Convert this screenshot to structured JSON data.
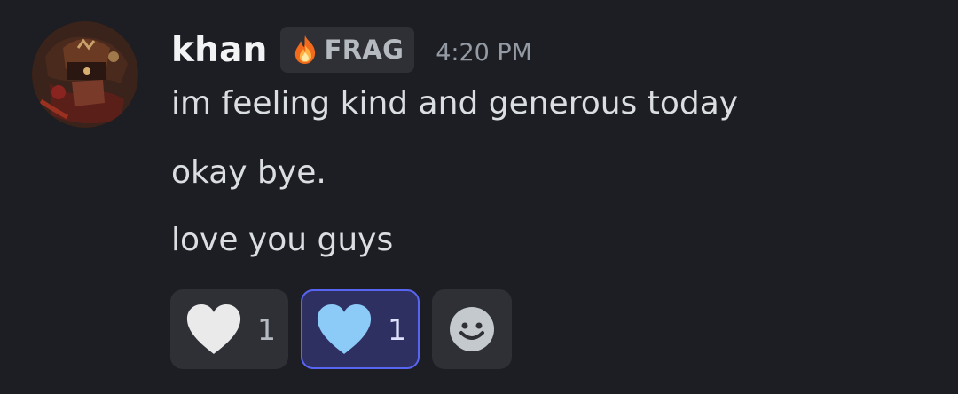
{
  "message": {
    "author": {
      "username": "khan",
      "avatar_icon": "avatar-image"
    },
    "tag": {
      "icon": "flame-icon",
      "label": "FRAG"
    },
    "timestamp": "4:20 PM",
    "lines": [
      "im feeling kind and generous today",
      "okay bye.",
      "love you guys"
    ],
    "reactions": [
      {
        "icon": "white-heart-icon",
        "emoji_color": "#eaeaea",
        "count": "1",
        "reacted": false
      },
      {
        "icon": "light-blue-heart-icon",
        "emoji_color": "#8ccaf7",
        "count": "1",
        "reacted": true
      }
    ],
    "add_reaction_icon": "smiley-face-icon"
  },
  "colors": {
    "background": "#1d1e23",
    "reaction_bg": "#2e3036",
    "reacted_bg": "#2f3062",
    "reacted_border": "#5865f2"
  }
}
